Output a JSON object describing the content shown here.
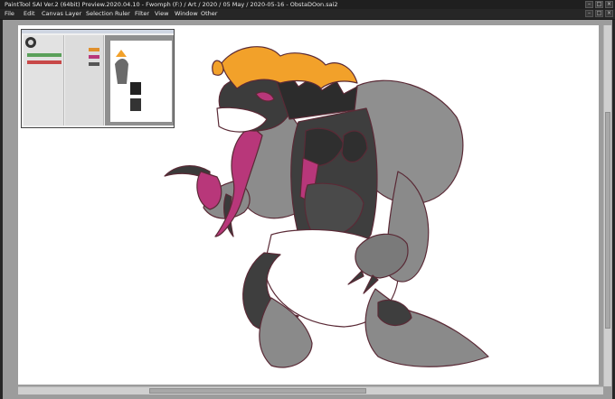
{
  "window": {
    "title": "PaintTool SAI Ver.2 (64bit) Preview.2020.04.10 - Fwomph (F:) / Art / 2020 / 05 May / 2020-05-16 - ObstaDOon.sai2",
    "minimize_glyph": "–",
    "maximize_glyph": "□",
    "close_glyph": "×"
  },
  "menu": {
    "items": [
      "File",
      "Edit",
      "Canvas",
      "Layer",
      "Selection",
      "Ruler",
      "Filter",
      "View",
      "Window",
      "Other"
    ]
  },
  "colors": {
    "titlebar_bg": "#1f1f1f",
    "menubar_bg": "#262626",
    "workspace_bg": "#9c9c9c",
    "canvas_bg": "#ffffff",
    "hair_orange": "#f2a12a",
    "tongue_magenta": "#b8377a",
    "fur_grey": "#8a8a8a",
    "body_dark": "#3a3a3a",
    "sketch_line": "#6a2a3a"
  },
  "icons": {
    "minimize": "minimize-icon",
    "maximize": "maximize-icon",
    "close": "close-icon"
  }
}
